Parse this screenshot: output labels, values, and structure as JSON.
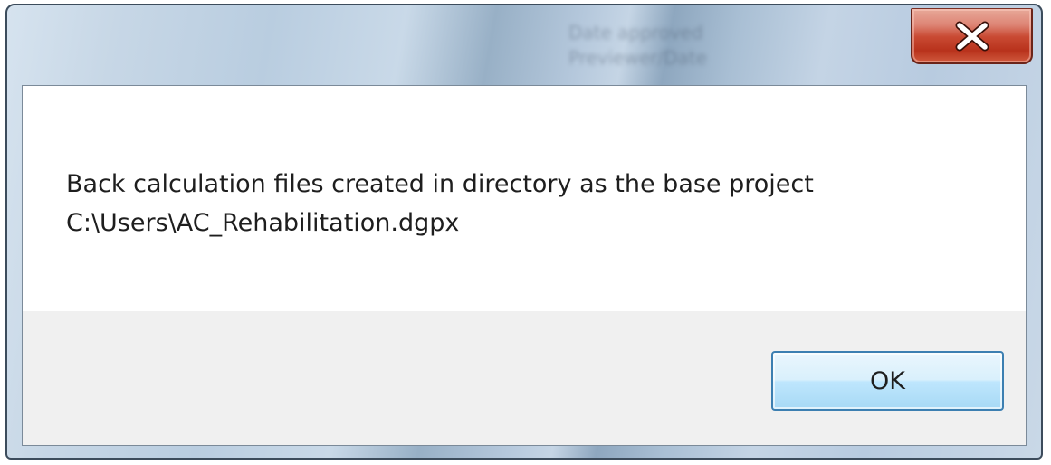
{
  "dialog": {
    "background_title_ghost": [
      "Date approved",
      "Previewer/Date"
    ],
    "close_button_glyph": "X",
    "message": {
      "line1": "Back calculation files created in directory as the base project",
      "line2": "C:\\Users\\AC_Rehabilitation.dgpx"
    },
    "ok_button_label": "OK"
  },
  "colors": {
    "close_button": "#c94a33",
    "ok_button_border": "#3c7fb1",
    "button_area_bg": "#f0f0f0"
  },
  "icons": [
    "close-icon"
  ]
}
